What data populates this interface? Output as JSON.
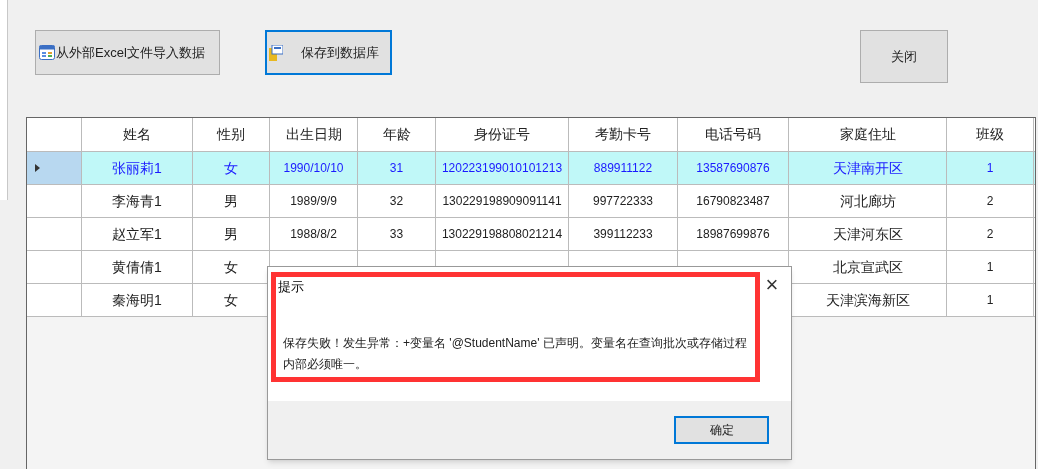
{
  "toolbar": {
    "buttons": [
      {
        "label": "从外部Excel文件导入数据",
        "kind": "import",
        "focused": false
      },
      {
        "label": "保存到数据库",
        "kind": "save",
        "focused": true
      },
      {
        "label": "关闭",
        "kind": "close",
        "focused": false
      }
    ]
  },
  "table": {
    "columns": [
      "姓名",
      "性别",
      "出生日期",
      "年龄",
      "身份证号",
      "考勤卡号",
      "电话号码",
      "家庭住址",
      "班级"
    ],
    "rows": [
      {
        "selected": true,
        "cells": [
          "张丽莉1",
          "女",
          "1990/10/10",
          "31",
          "120223199010101213",
          "889911122",
          "13587690876",
          "天津南开区",
          "1"
        ]
      },
      {
        "selected": false,
        "cells": [
          "李海青1",
          "男",
          "1989/9/9",
          "32",
          "130229198909091141",
          "997722333",
          "16790823487",
          "河北廊坊",
          "2"
        ]
      },
      {
        "selected": false,
        "cells": [
          "赵立军1",
          "男",
          "1988/8/2",
          "33",
          "130229198808021214",
          "399112233",
          "18987699876",
          "天津河东区",
          "2"
        ]
      },
      {
        "selected": false,
        "cells": [
          "黄倩倩1",
          "女",
          null,
          null,
          null,
          null,
          null,
          "北京宣武区",
          "1"
        ]
      },
      {
        "selected": false,
        "cells": [
          "秦海明1",
          "女",
          null,
          null,
          null,
          null,
          null,
          "天津滨海新区",
          "1"
        ]
      }
    ]
  },
  "dialog": {
    "title": "提示",
    "close": "×",
    "message": "保存失败！发生异常：+变量名 '@StudentName' 已声明。变量名在查询批次或存储过程内部必须唯一。",
    "ok": "确定"
  }
}
